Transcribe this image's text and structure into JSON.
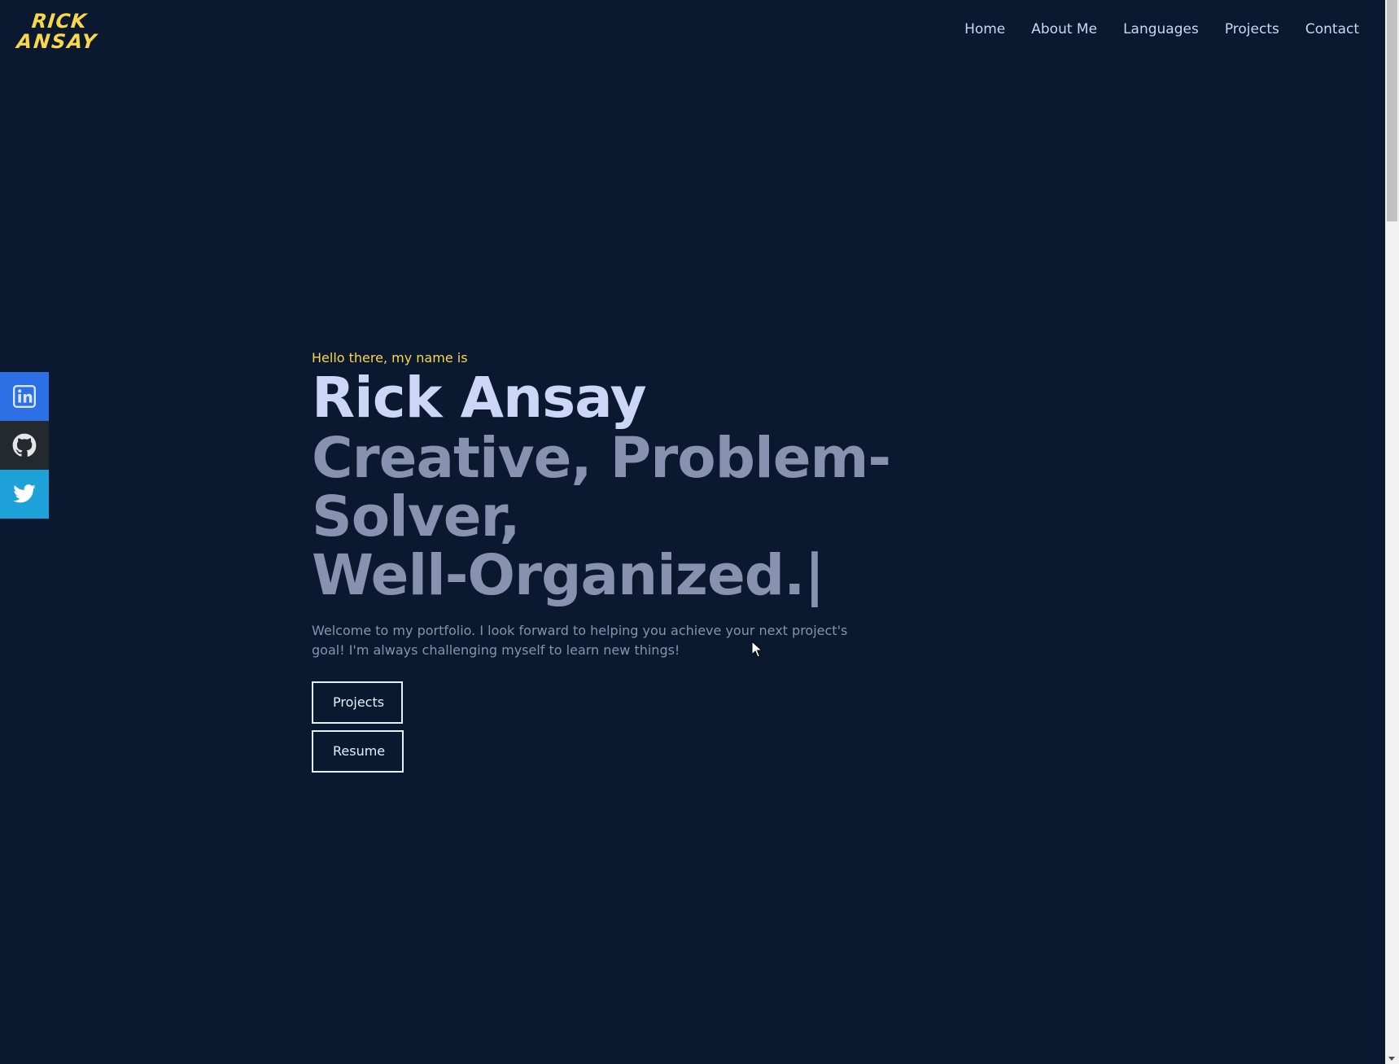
{
  "logo": {
    "line1": "RICK",
    "line2": "ANSAY"
  },
  "nav": {
    "items": [
      {
        "label": "Home"
      },
      {
        "label": "About Me"
      },
      {
        "label": "Languages"
      },
      {
        "label": "Projects"
      },
      {
        "label": "Contact"
      }
    ]
  },
  "social": {
    "items": [
      {
        "icon": "linkedin-icon",
        "color": "#2d6fe4"
      },
      {
        "icon": "github-icon",
        "color": "#24292f"
      },
      {
        "icon": "twitter-icon",
        "color": "#1da1d8"
      }
    ]
  },
  "hero": {
    "greeting": "Hello there, my name is",
    "name": "Rick Ansay",
    "tagline_line1": "Creative, Problem-Solver,",
    "tagline_line2": "Well-Organized.|",
    "intro": "Welcome to my portfolio. I look forward to helping you achieve your next project's goal! I'm always challenging myself to learn new things!",
    "buttons": {
      "projects": "Projects",
      "resume": "Resume"
    }
  },
  "colors": {
    "background": "#0a192f",
    "accent": "#f8d74a",
    "heading": "#ccd6f6",
    "muted": "#8892b0"
  }
}
